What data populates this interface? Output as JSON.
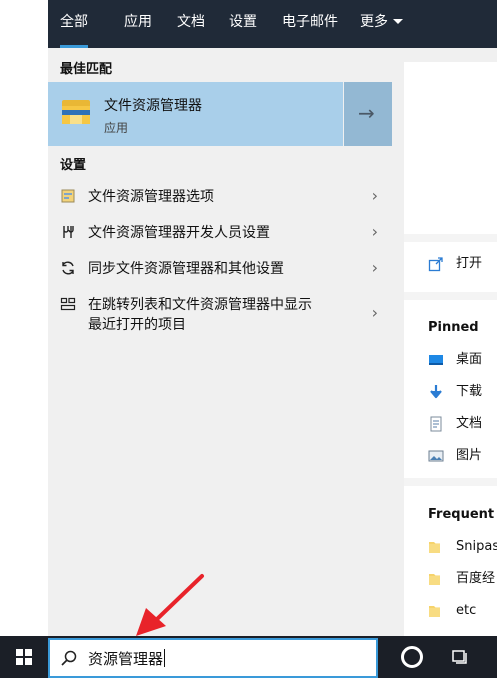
{
  "tabs": [
    {
      "label": "全部",
      "active": true
    },
    {
      "label": "应用",
      "active": false
    },
    {
      "label": "文档",
      "active": false
    },
    {
      "label": "设置",
      "active": false
    },
    {
      "label": "电子邮件",
      "active": false
    },
    {
      "label": "更多",
      "active": false
    }
  ],
  "best_match": {
    "section_title": "最佳匹配",
    "title": "文件资源管理器",
    "subtitle": "应用"
  },
  "settings": {
    "section_title": "设置",
    "items": [
      {
        "label": "文件资源管理器选项",
        "icon": "folder-options-icon"
      },
      {
        "label": "文件资源管理器开发人员设置",
        "icon": "developer-tools-icon"
      },
      {
        "label": "同步文件资源管理器和其他设置",
        "icon": "sync-icon"
      },
      {
        "label_line1": "在跳转列表和文件资源管理器中显示",
        "label_line2": "最近打开的项目",
        "icon": "start-layout-icon"
      }
    ]
  },
  "detail": {
    "open_label": "打开",
    "pinned_title": "Pinned",
    "pinned": [
      {
        "label": "桌面",
        "icon": "desktop-icon"
      },
      {
        "label": "下载",
        "icon": "download-icon"
      },
      {
        "label": "文档",
        "icon": "document-icon"
      },
      {
        "label": "图片",
        "icon": "pictures-icon"
      }
    ],
    "frequent_title": "Frequent",
    "frequent": [
      {
        "label": "Snipas",
        "icon": "folder-icon"
      },
      {
        "label": "百度经",
        "icon": "folder-icon"
      },
      {
        "label": "etc",
        "icon": "folder-icon"
      }
    ]
  },
  "search": {
    "query": "资源管理器"
  },
  "colors": {
    "topbar": "#202a38",
    "accent": "#3a9ad9",
    "best_match_bg": "#a9cfea",
    "panel_bg": "#f0f0f0",
    "annotation": "#e8232a"
  }
}
